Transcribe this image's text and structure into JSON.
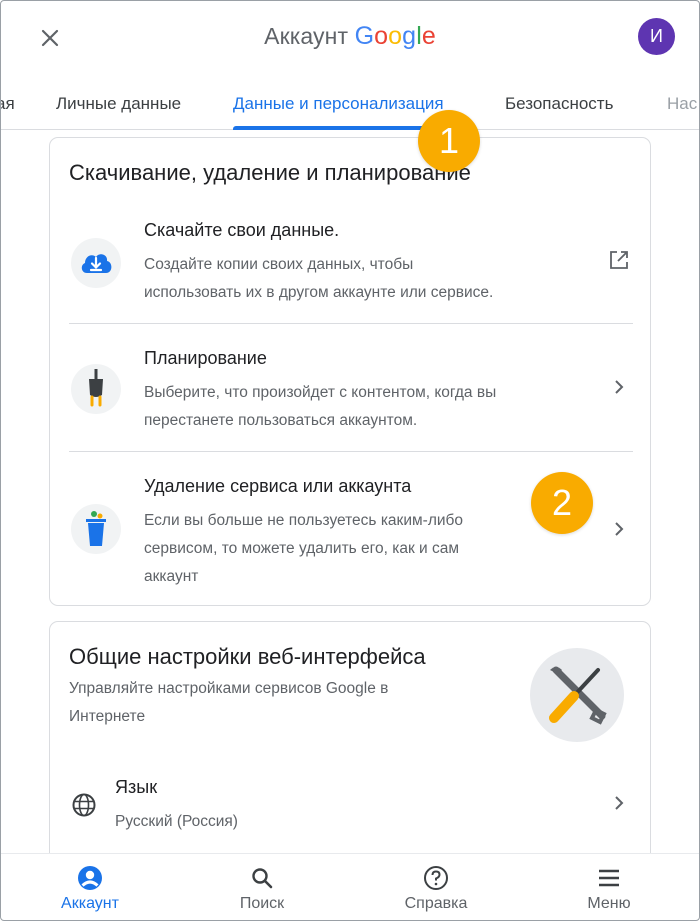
{
  "header": {
    "title_prefix": "Аккаунт",
    "title_brand": "Google",
    "avatar_letter": "И"
  },
  "tabs": [
    {
      "label": "ая"
    },
    {
      "label": "Личные данные"
    },
    {
      "label": "Данные и персонализация",
      "active": true
    },
    {
      "label": "Безопасность"
    },
    {
      "label": "Нас"
    }
  ],
  "badges": [
    "1",
    "2"
  ],
  "card_data": {
    "title": "Скачивание, удаление и планирование",
    "rows": [
      {
        "title": "Скачайте свои данные.",
        "desc_line1": "Создайте копии своих данных, чтобы",
        "desc_line2": "использовать их в другом аккаунте или сервисе.",
        "icon": "cloud-download-icon",
        "action": "open-in-new-icon"
      },
      {
        "title": "Планирование",
        "desc_line1": "Выберите, что произойдет с контентом, когда вы",
        "desc_line2": "перестанете пользоваться аккаунтом.",
        "icon": "plug-icon",
        "action": "chevron-right-icon"
      },
      {
        "title": "Удаление сервиса или аккаунта",
        "desc_line1": "Если вы больше не пользуетесь каким-либо",
        "desc_line2": "сервисом, то можете удалить его, как и сам",
        "desc_line3": "аккаунт",
        "icon": "trash-bin-icon",
        "action": "chevron-right-icon"
      }
    ]
  },
  "card_web": {
    "title": "Общие настройки веб-интерфейса",
    "desc_line1": "Управляйте настройками сервисов Google в",
    "desc_line2": "Интернете",
    "illustration": "tools-icon",
    "language": {
      "title": "Язык",
      "value": "Русский (Россия)",
      "icon": "globe-icon"
    }
  },
  "bottom_nav": [
    {
      "label": "Аккаунт",
      "icon": "account-circle-icon",
      "active": true
    },
    {
      "label": "Поиск",
      "icon": "search-icon"
    },
    {
      "label": "Справка",
      "icon": "help-icon"
    },
    {
      "label": "Меню",
      "icon": "menu-icon"
    }
  ],
  "colors": {
    "accent": "#1a73e8",
    "badge": "#f9ab00",
    "avatar": "#5e35b1",
    "text_primary": "#202124",
    "text_secondary": "#5f6368",
    "divider": "#dadce0"
  }
}
